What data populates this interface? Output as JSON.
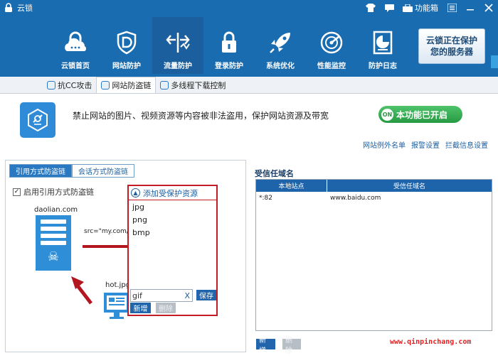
{
  "window": {
    "title": "云锁",
    "toolbox_label": "功能箱"
  },
  "toolbar": {
    "items": [
      {
        "label": "云锁首页",
        "icon": "lock-cloud-icon"
      },
      {
        "label": "网站防护",
        "icon": "shield-d-icon"
      },
      {
        "label": "流量防护",
        "icon": "traffic-icon"
      },
      {
        "label": "登录防护",
        "icon": "padlock-icon"
      },
      {
        "label": "系统优化",
        "icon": "rocket-icon"
      },
      {
        "label": "性能监控",
        "icon": "radar-icon"
      },
      {
        "label": "防护日志",
        "icon": "log-icon"
      }
    ],
    "active_index": 2,
    "protect_line1": "云锁正在保护",
    "protect_line2": "您的服务器"
  },
  "subtabs": [
    {
      "label": "抗CC攻击"
    },
    {
      "label": "网站防盗链"
    },
    {
      "label": "多线程下载控制"
    }
  ],
  "banner": {
    "description": "禁止网站的图片、视频资源等内容被非法盗用，保护网站资源及带宽",
    "toggle_badge": "ON",
    "toggle_label": "本功能已开启",
    "links": [
      "网站例外名单",
      "报警设置",
      "拦截信息设置"
    ]
  },
  "left": {
    "tabs": [
      "引用方式防盗链",
      "会话方式防盗链"
    ],
    "enable_label": "启用引用方式防盗链",
    "site_label": "daolian.com",
    "src_text": "src=\"my.com/hot",
    "hot_label": "hot.jpg"
  },
  "popup": {
    "title": "添加受保护资源",
    "resources": [
      "jpg",
      "png",
      "bmp"
    ],
    "input_value": "gif",
    "clear": "X",
    "save": "保存",
    "add": "新增",
    "delete": "删除"
  },
  "right": {
    "title": "受信任域名",
    "columns": [
      "本地站点",
      "受信任域名"
    ],
    "rows": [
      {
        "local": "*:82",
        "trusted": "www.baidu.com"
      }
    ],
    "add": "新增",
    "delete": "删除"
  },
  "watermark": "www.qinpinchang.com",
  "colors": {
    "toolbar_blue": "#1a6cb1",
    "accent_green": "#279a44",
    "highlight_red": "#c41c27"
  }
}
